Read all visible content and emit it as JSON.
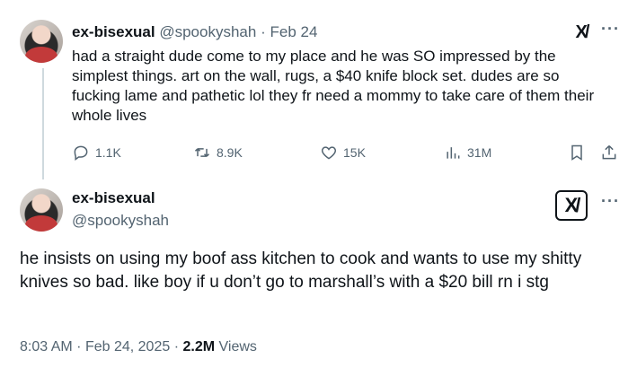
{
  "post1": {
    "display_name": "ex-bisexual",
    "handle": "@spookyshah",
    "separator": "·",
    "date": "Feb 24",
    "text": "had a straight dude come to my place and he was SO impressed by the simplest things. art on the wall, rugs, a $40 knife block set. dudes are so fucking lame and pathetic lol they fr need a mommy to take care of them their whole lives",
    "replies": "1.1K",
    "reposts": "8.9K",
    "likes": "15K",
    "views": "31M"
  },
  "post2": {
    "display_name": "ex-bisexual",
    "handle": "@spookyshah",
    "text": "he insists on using my boof ass kitchen to cook and wants to use my shitty knives so bad. like boy if u don’t go to marshall’s with a $20 bill rn i stg",
    "time": "8:03 AM",
    "separator": "·",
    "date": "Feb 24, 2025",
    "views_count": "2.2M",
    "views_label": "Views"
  },
  "icons": {
    "grok": "grok-icon",
    "more": "more-icon",
    "reply": "reply-icon",
    "repost": "repost-icon",
    "like": "heart-icon",
    "views": "views-icon",
    "bookmark": "bookmark-icon",
    "share": "share-icon"
  },
  "grok_glyph": "X/",
  "more_glyph": "···",
  "colors": {
    "text": "#0f1419",
    "muted": "#536471",
    "thread_line": "#cfd9de"
  }
}
